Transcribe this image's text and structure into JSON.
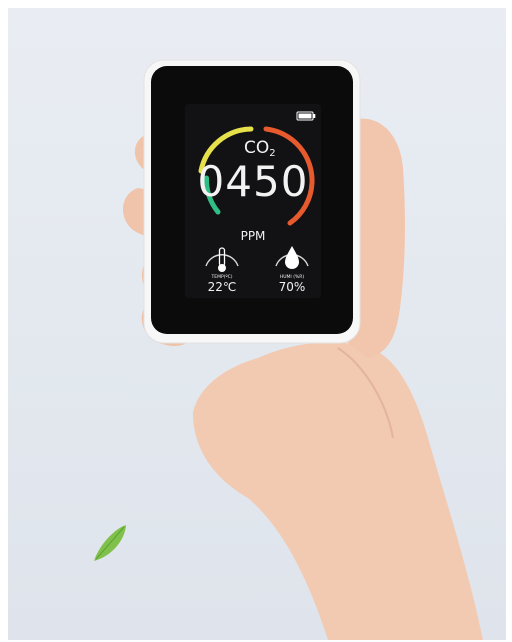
{
  "device": {
    "co2_label_main": "CO",
    "co2_label_sub": "2",
    "co2_value": "0450",
    "co2_unit": "PPM",
    "temp_label": "TEMP(ºC)",
    "temp_value": "22℃",
    "humi_label": "HUMI (%R)",
    "humi_value": "70%",
    "gauge_colors": [
      "#2fbf86",
      "#e6e14a",
      "#e65a2e"
    ],
    "battery_level": 1.0
  },
  "icons": {
    "thermometer": "thermometer-icon",
    "droplet": "droplet-icon",
    "battery": "battery-icon",
    "leaf": "leaf-icon"
  }
}
